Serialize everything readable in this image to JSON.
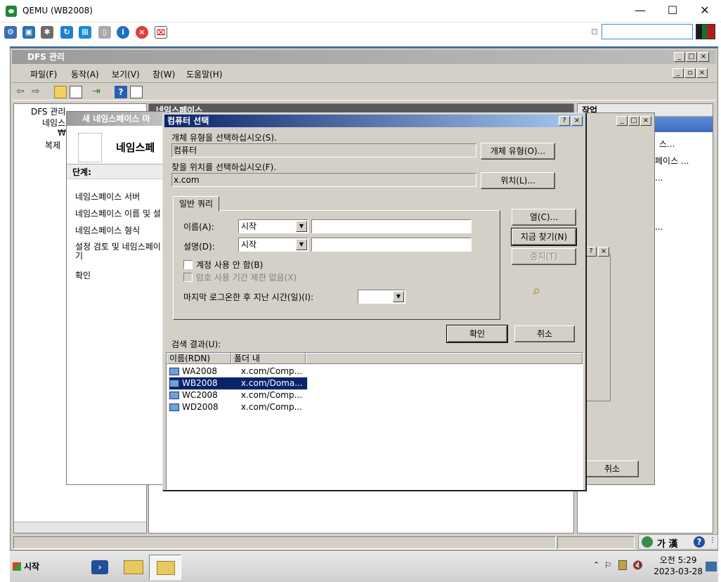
{
  "host": {
    "title": "QEMU (WB2008)",
    "controls": {
      "minimize": "—",
      "maximize": "☐",
      "close": "✕"
    }
  },
  "mmc": {
    "title": "DFS 관리",
    "menu": [
      "파일(F)",
      "동작(A)",
      "보기(V)",
      "창(W)",
      "도움말(H)"
    ],
    "tree": {
      "root": "DFS 관리",
      "namespaces": "네임스",
      "child": "₩",
      "replication": "복제"
    },
    "center_header": "네임스페이스",
    "action_header": "작업",
    "actions": [
      "스...",
      "페이스 ...",
      "...",
      "..."
    ]
  },
  "wizard": {
    "title": "새 네임스페이스 마",
    "heading": "네임스페",
    "steps_label": "단계:",
    "steps": [
      "네임스페이스 서버",
      "네임스페이스 이름 및 설",
      "네임스페이스 형식",
      "설정 검토 및 네임스페이\n기",
      "확인"
    ]
  },
  "bg_dialog": {
    "cancel": "취소"
  },
  "computer_select": {
    "title": "컴퓨터 선택",
    "object_type_label": "개체 유형을 선택하십시오(S).",
    "object_type_value": "컴퓨터",
    "object_type_button": "개체 유형(O)...",
    "location_label": "찾을 위치를 선택하십시오(F).",
    "location_value": "x.com",
    "location_button": "위치(L)...",
    "tab": "일반 쿼리",
    "name_label": "이름(A):",
    "name_mode": "시작",
    "desc_label": "설명(D):",
    "desc_mode": "시작",
    "check_disabled_accounts": "계정 사용 안 함(B)",
    "check_no_expire": "암호 사용 기간 제한 없음(X)",
    "last_logon_label": "마지막 로그온한 후 지난 시간(일)(I):",
    "columns_button": "열(C)...",
    "find_now_button": "지금 찾기(N)",
    "stop_button": "중지(T)",
    "ok_button": "확인",
    "cancel_button": "취소",
    "results_label": "검색 결과(U):",
    "results_headers": [
      "이름(RDN)",
      "폴더 내"
    ],
    "results": [
      {
        "name": "WA2008",
        "folder": "x.com/Comp..."
      },
      {
        "name": "WB2008",
        "folder": "x.com/Doma..."
      },
      {
        "name": "WC2008",
        "folder": "x.com/Comp..."
      },
      {
        "name": "WD2008",
        "folder": "x.com/Comp..."
      }
    ]
  },
  "taskbar": {
    "start": "시작",
    "ime": "가 漢",
    "clock_time": "오전 5:29",
    "clock_date": "2023-03-28"
  }
}
